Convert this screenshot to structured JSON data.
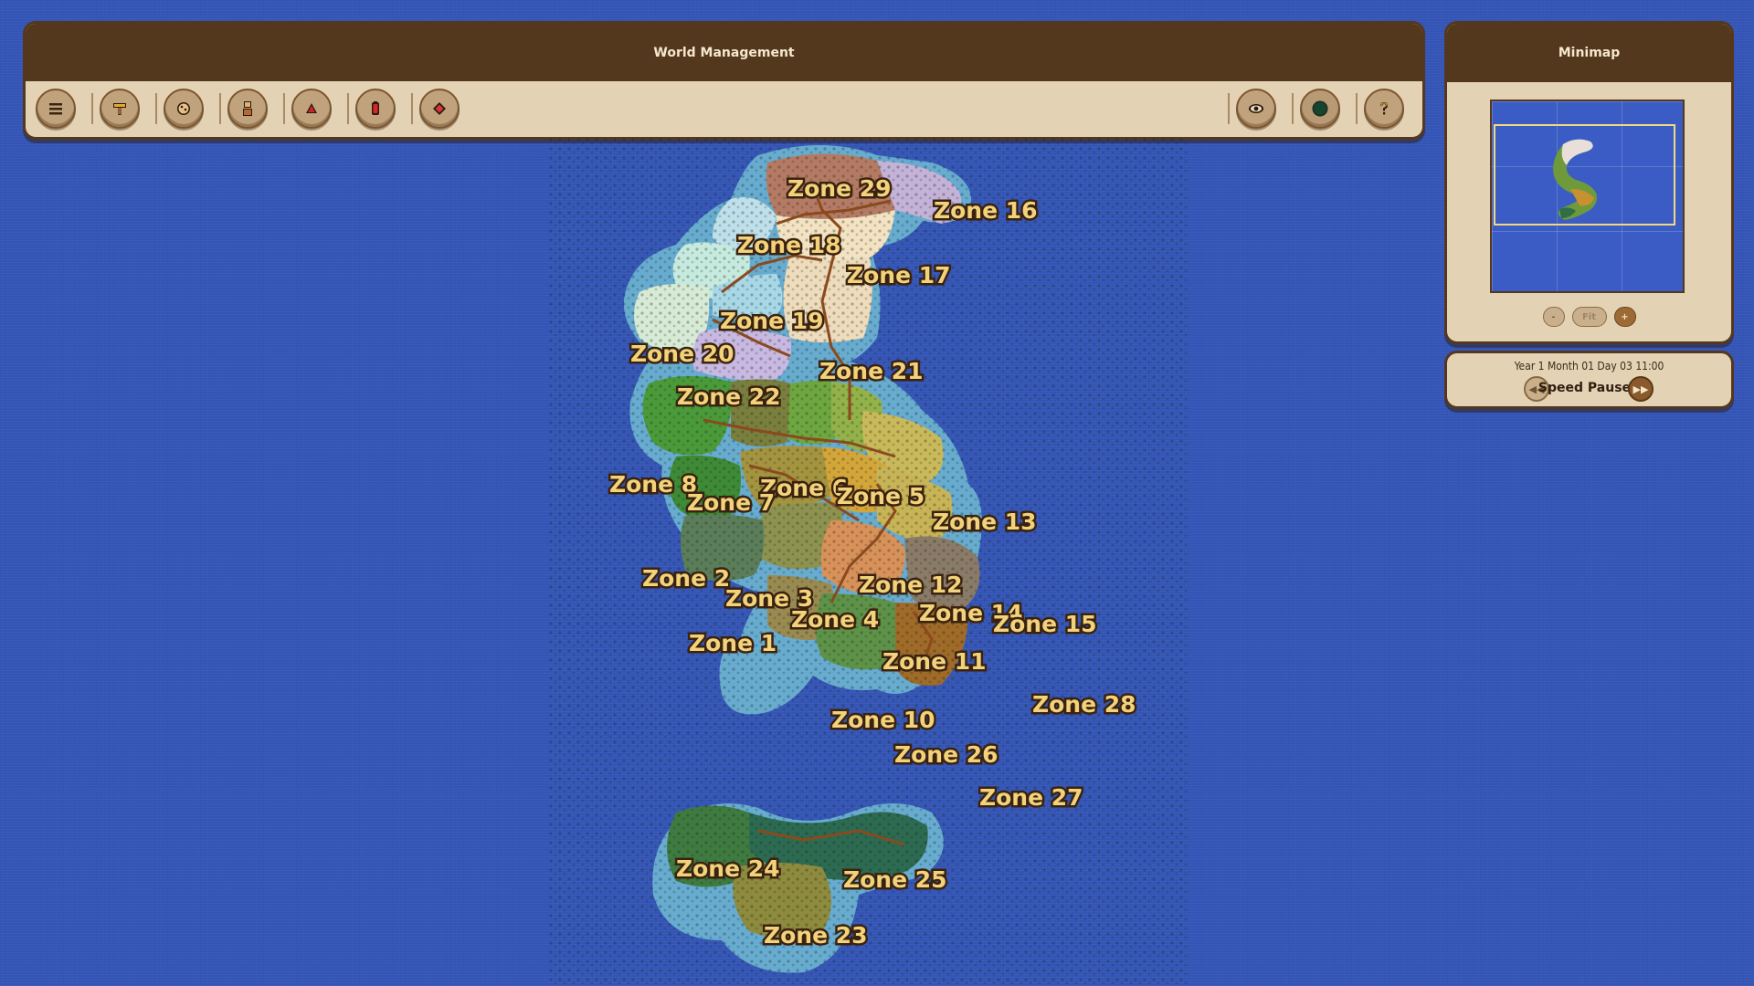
{
  "header": {
    "title": "World Management"
  },
  "toolbar": {
    "left_tools": [
      {
        "icon": "menu-icon"
      },
      {
        "icon": "build-hammer-icon"
      },
      {
        "icon": "resources-icon"
      },
      {
        "icon": "citizens-icon"
      },
      {
        "icon": "combat-icon"
      },
      {
        "icon": "potion-icon"
      },
      {
        "icon": "magic-icon"
      }
    ],
    "right_tools": [
      {
        "icon": "eye-icon"
      },
      {
        "icon": "globe-icon"
      },
      {
        "icon": "help-icon"
      }
    ]
  },
  "minimap": {
    "title": "Minimap",
    "zoom_out": "-",
    "fit": "Fit",
    "zoom_in": "+"
  },
  "time": {
    "datetime": "Year 1  Month 01  Day 03  11:00",
    "speed_label": "Speed Paused",
    "slower_icon": "rewind-icon",
    "faster_icon": "fast-forward-icon"
  },
  "map": {
    "zones": [
      {
        "id": "zone-29",
        "label": "Zone 29"
      },
      {
        "id": "zone-16",
        "label": "Zone 16"
      },
      {
        "id": "zone-18",
        "label": "Zone 18"
      },
      {
        "id": "zone-17",
        "label": "Zone 17"
      },
      {
        "id": "zone-19",
        "label": "Zone 19"
      },
      {
        "id": "zone-20",
        "label": "Zone 20"
      },
      {
        "id": "zone-21",
        "label": "Zone 21"
      },
      {
        "id": "zone-22",
        "label": "Zone 22"
      },
      {
        "id": "zone-8",
        "label": "Zone 8"
      },
      {
        "id": "zone-6",
        "label": "Zone 6"
      },
      {
        "id": "zone-5",
        "label": "Zone 5"
      },
      {
        "id": "zone-7",
        "label": "Zone 7"
      },
      {
        "id": "zone-13",
        "label": "Zone 13"
      },
      {
        "id": "zone-2",
        "label": "Zone 2"
      },
      {
        "id": "zone-12",
        "label": "Zone 12"
      },
      {
        "id": "zone-3",
        "label": "Zone 3"
      },
      {
        "id": "zone-14",
        "label": "Zone 14"
      },
      {
        "id": "zone-4",
        "label": "Zone 4"
      },
      {
        "id": "zone-15",
        "label": "Zone 15"
      },
      {
        "id": "zone-1",
        "label": "Zone 1"
      },
      {
        "id": "zone-11",
        "label": "Zone 11"
      },
      {
        "id": "zone-28",
        "label": "Zone 28"
      },
      {
        "id": "zone-10",
        "label": "Zone 10"
      },
      {
        "id": "zone-26",
        "label": "Zone 26"
      },
      {
        "id": "zone-27",
        "label": "Zone 27"
      },
      {
        "id": "zone-24",
        "label": "Zone 24"
      },
      {
        "id": "zone-25",
        "label": "Zone 25"
      },
      {
        "id": "zone-23",
        "label": "Zone 23"
      }
    ]
  }
}
